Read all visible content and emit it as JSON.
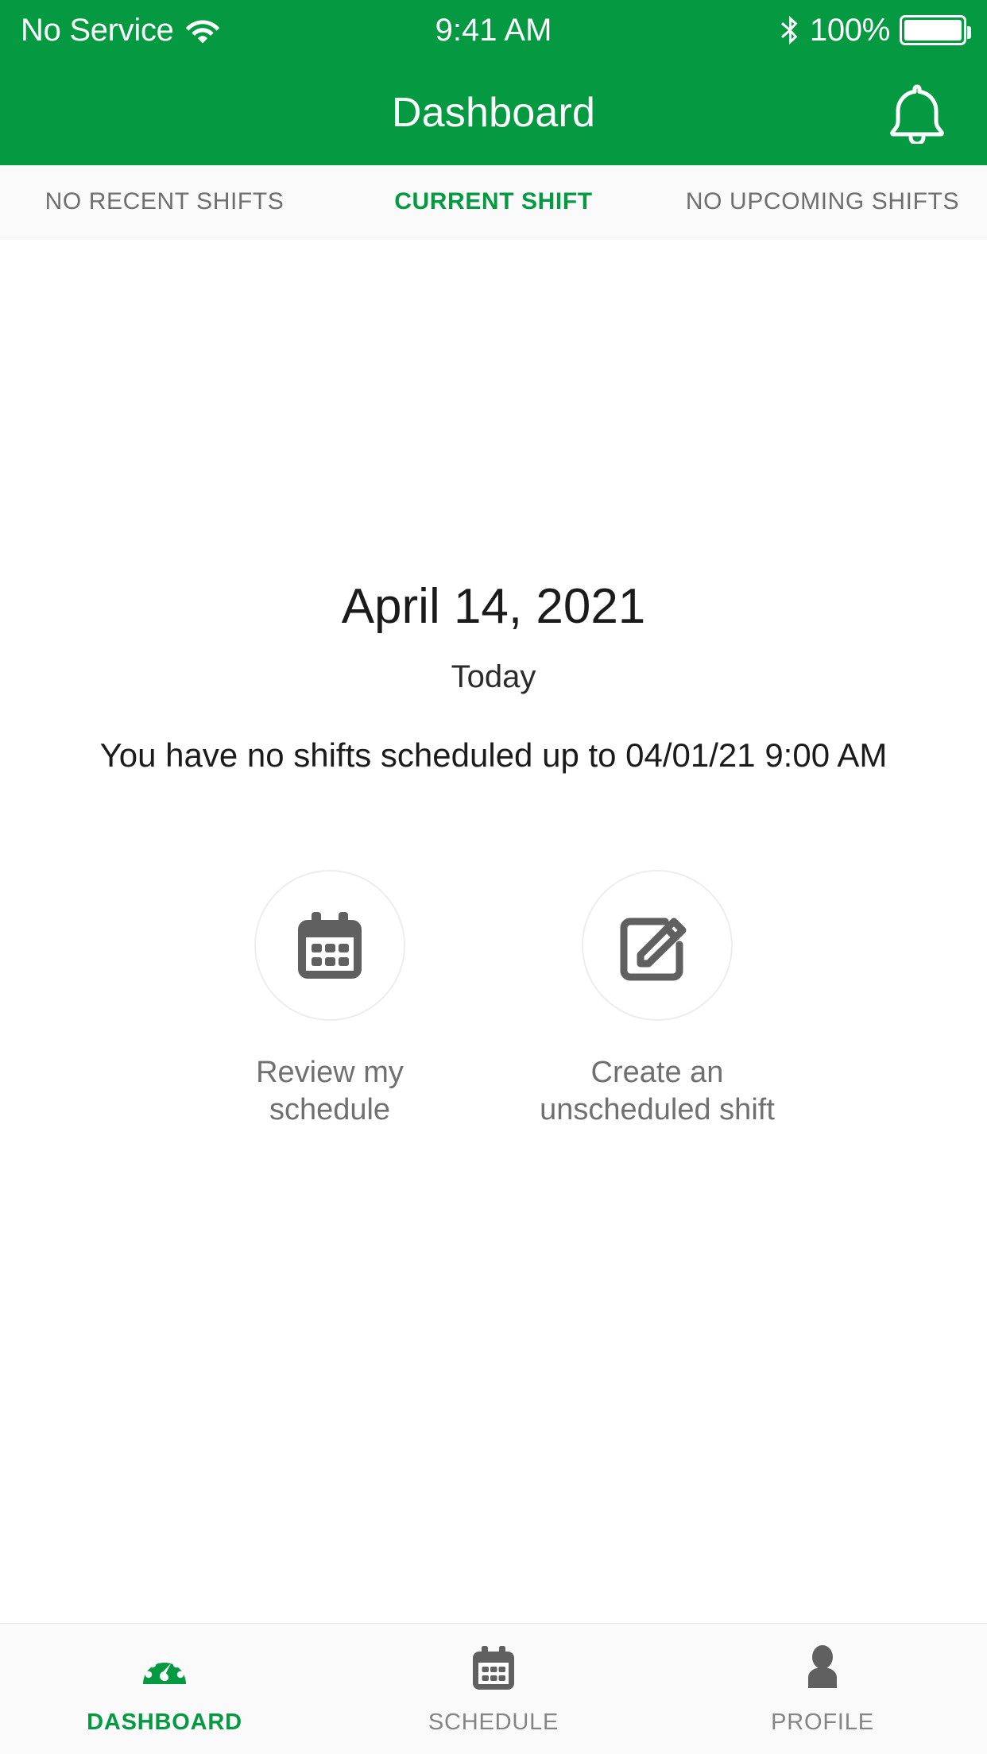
{
  "colors": {
    "brand_green": "#059a41",
    "status_bar_bg": "#059a41",
    "tabbar_bg": "#fafafa",
    "content_bg": "#ffffff",
    "inactive_text": "#6e6e6e",
    "icon_gray": "#606060"
  },
  "status_bar": {
    "carrier": "No Service",
    "wifi_icon": "wifi-icon",
    "time": "9:41 AM",
    "bluetooth_icon": "bluetooth-icon",
    "battery_percent": "100%",
    "battery_icon": "battery-full-icon"
  },
  "nav_bar": {
    "title": "Dashboard",
    "notification_icon": "bell-icon"
  },
  "tabs": [
    {
      "label": "NO RECENT SHIFTS",
      "active": false
    },
    {
      "label": "CURRENT SHIFT",
      "active": true
    },
    {
      "label": "NO UPCOMING SHIFTS",
      "active": false
    }
  ],
  "main": {
    "date": "April 14, 2021",
    "date_relative": "Today",
    "shift_message": "You have no shifts scheduled up to 04/01/21 9:00 AM",
    "actions": [
      {
        "label": "Review my schedule",
        "icon": "calendar-icon"
      },
      {
        "label": "Create an unscheduled shift",
        "icon": "edit-square-icon"
      }
    ]
  },
  "bottom_nav": [
    {
      "label": "DASHBOARD",
      "icon": "gauge-icon",
      "active": true
    },
    {
      "label": "SCHEDULE",
      "icon": "calendar-icon",
      "active": false
    },
    {
      "label": "PROFILE",
      "icon": "person-icon",
      "active": false
    }
  ]
}
